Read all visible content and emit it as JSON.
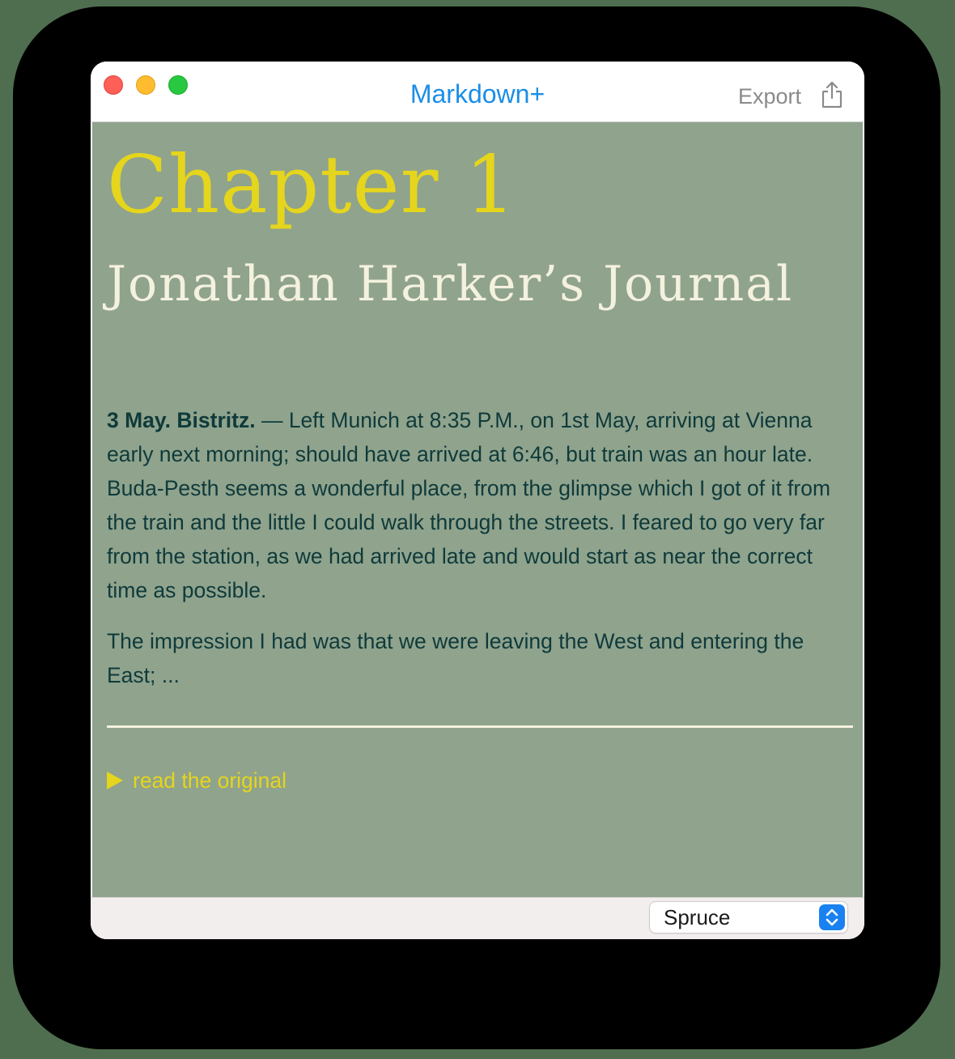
{
  "window": {
    "title": "Markdown+",
    "export_label": "Export"
  },
  "document": {
    "h1": "Chapter 1",
    "h2": "Jonathan Harker’s Journal",
    "para1_bold": "3 May. Bistritz.",
    "para1_text": " — Left Munich at 8:35 P.M., on 1st May, arriving at Vienna early next morning; should have arrived at 6:46, but train was an hour late. Buda-Pesth seems a wonderful place, from the glimpse which I got of it from the train and the little I could walk through the streets. I feared to go very far from the station, as we had arrived late and would start as near the correct time as possible.",
    "para2_text": "The impression I had was that we were leaving the West and entering the East; ...",
    "details_summary": "read the original"
  },
  "footer": {
    "theme_selected": "Spruce"
  },
  "colors": {
    "content_background": "#8fa38d",
    "heading1": "#e5d51c",
    "heading2": "#f4f1de",
    "body_text": "#0f3a3a",
    "accent_title": "#1b8ee6"
  },
  "icons": {
    "close": "close-button",
    "minimize": "minimize-button",
    "zoom": "zoom-button",
    "share": "share-icon",
    "disclosure": "disclosure-triangle-icon",
    "select": "chevron-up-down-icon"
  }
}
